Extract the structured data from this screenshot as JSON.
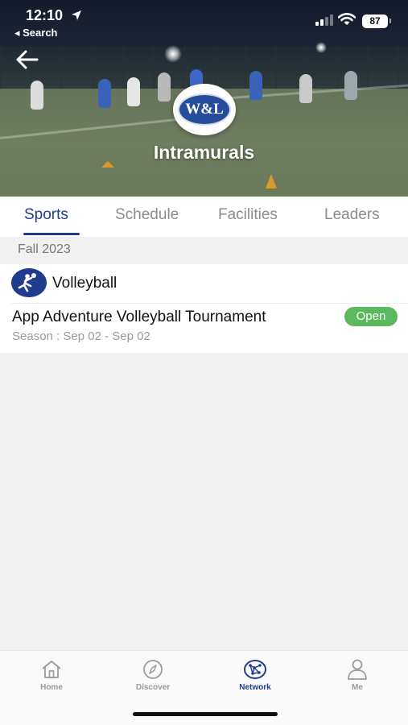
{
  "status_bar": {
    "time": "12:10",
    "back_app": "◂ Search",
    "battery": "87"
  },
  "header": {
    "logo_text": "W&L",
    "title": "Intramurals"
  },
  "tabs": [
    {
      "label": "Sports",
      "active": true
    },
    {
      "label": "Schedule",
      "active": false
    },
    {
      "label": "Facilities",
      "active": false
    },
    {
      "label": "Leaders",
      "active": false
    }
  ],
  "season": {
    "label": "Fall 2023"
  },
  "sport": {
    "name": "Volleyball",
    "icon": "volleyball-player-icon",
    "event": {
      "title": "App Adventure Volleyball Tournament",
      "dates": "Season : Sep 02 - Sep 02",
      "status": "Open"
    }
  },
  "bottom_nav": [
    {
      "label": "Home",
      "icon": "home-icon",
      "active": false
    },
    {
      "label": "Discover",
      "icon": "compass-icon",
      "active": false
    },
    {
      "label": "Network",
      "icon": "network-icon",
      "active": true
    },
    {
      "label": "Me",
      "icon": "person-icon",
      "active": false
    }
  ],
  "colors": {
    "brand": "#1f3c8e",
    "open_badge": "#5cb85c",
    "background": "#f1f1f1"
  }
}
